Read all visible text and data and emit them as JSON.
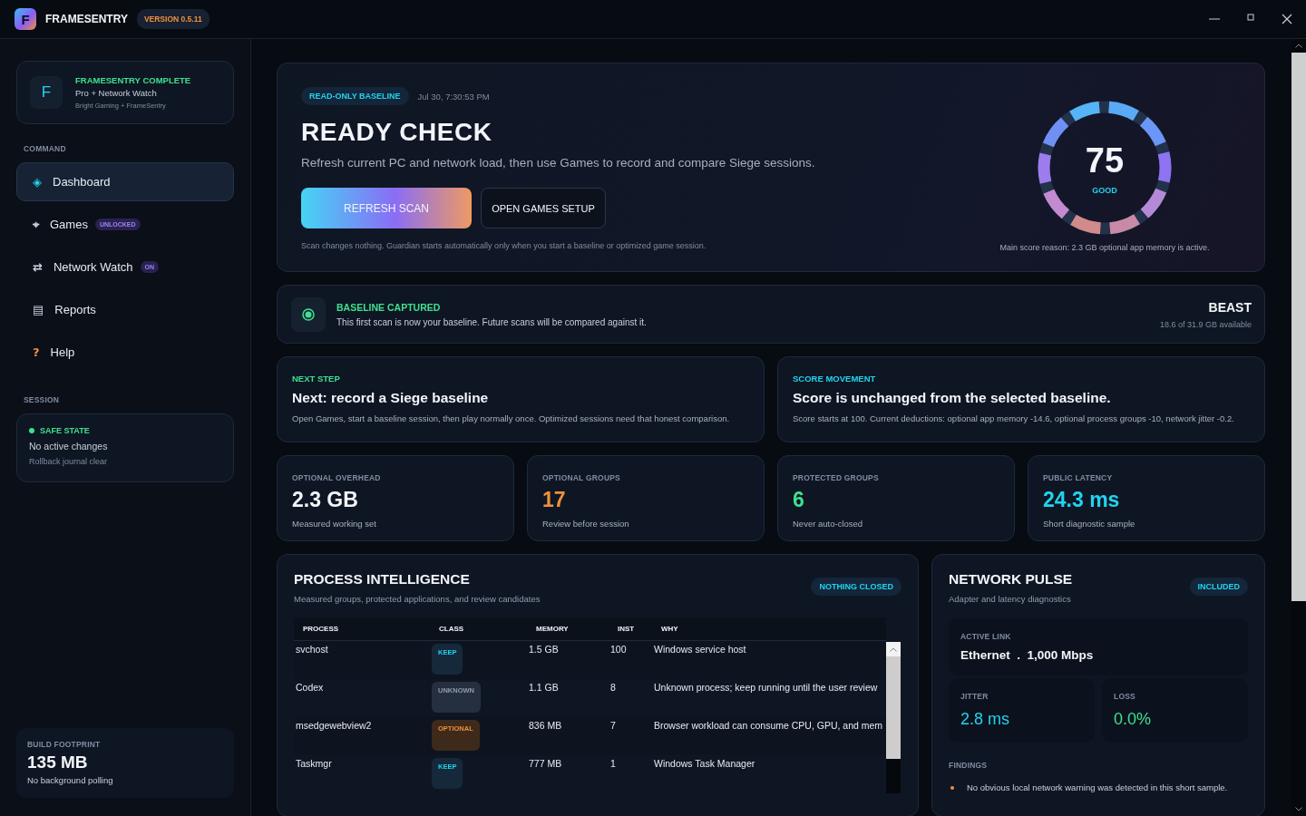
{
  "app": {
    "logo_letter": "F",
    "name": "FRAMESENTRY",
    "version": "VERSION 0.5.11"
  },
  "sidebar": {
    "brand": {
      "letter": "F",
      "title": "FRAMESENTRY COMPLETE",
      "subtitle": "Pro + Network Watch",
      "caption": "Bright Gaming + FrameSentry"
    },
    "sections": [
      {
        "heading": "COMMAND",
        "items": [
          {
            "icon": "◈",
            "color": "#22d3ee",
            "label": "Dashboard",
            "selected": true
          },
          {
            "icon": "⌖",
            "color": "#c7d0dc",
            "label": "Games",
            "badge": "UNLOCKED",
            "selected": false
          },
          {
            "icon": "⇄",
            "color": "#c7d0dc",
            "label": "Network Watch",
            "badge": "ON",
            "selected": false
          },
          {
            "icon": "▤",
            "color": "#c7d0dc",
            "label": "Reports",
            "selected": false
          },
          {
            "icon": "?",
            "color": "#f0903c",
            "label": "Help",
            "selected": false
          }
        ]
      }
    ],
    "session": {
      "heading": "SESSION",
      "status": "SAFE STATE",
      "line": "No active changes",
      "caption": "Rollback journal clear"
    },
    "footprint": {
      "label": "BUILD FOOTPRINT",
      "value": "135 MB",
      "note": "No background polling"
    }
  },
  "hero": {
    "tag": "READ-ONLY BASELINE",
    "timestamp": "Jul 30, 7:30:53 PM",
    "title": "READY CHECK",
    "description": "Refresh current PC and network load, then use Games to record and compare Siege sessions.",
    "buttons": [
      {
        "label": "REFRESH SCAN",
        "kind": "primary"
      },
      {
        "label": "OPEN GAMES SETUP",
        "kind": "secondary"
      }
    ],
    "note": "Scan changes nothing. Guardian starts automatically only when you start a baseline or optimized game session.",
    "score": {
      "value": "75",
      "rating": "GOOD",
      "reason": "Main score reason: 2.3 GB optional app memory is active."
    }
  },
  "baseline": {
    "title": "BASELINE CAPTURED",
    "text": "This first scan is now your baseline. Future scans will be compared against it.",
    "machine": "BEAST",
    "memory": "18.6 of 31.9 GB available"
  },
  "info_cards": [
    {
      "heading": "NEXT STEP",
      "color": "#3ee08f",
      "title": "Next: record a Siege baseline",
      "text": "Open Games, start a baseline session, then play normally once. Optimized sessions need that honest comparison."
    },
    {
      "heading": "SCORE MOVEMENT",
      "color": "#22d3ee",
      "title": "Score is unchanged from the selected baseline.",
      "text": "Score starts at 100. Current deductions: optional app memory -14.6, optional process groups -10, network jitter -0.2."
    }
  ],
  "stats": [
    {
      "label": "OPTIONAL OVERHEAD",
      "value": "2.3 GB",
      "color": "#f2f5f9",
      "note": "Measured working set"
    },
    {
      "label": "OPTIONAL GROUPS",
      "value": "17",
      "color": "#f0903c",
      "note": "Review before session"
    },
    {
      "label": "PROTECTED GROUPS",
      "value": "6",
      "color": "#3ee08f",
      "note": "Never auto-closed"
    },
    {
      "label": "PUBLIC LATENCY",
      "value": "24.3 ms",
      "color": "#22d3ee",
      "note": "Short diagnostic sample"
    }
  ],
  "process_panel": {
    "title": "PROCESS INTELLIGENCE",
    "subtitle": "Measured groups, protected applications, and review candidates",
    "badge": "NOTHING CLOSED",
    "table": {
      "columns": [
        "PROCESS",
        "CLASS",
        "MEMORY",
        "INST",
        "WHY"
      ],
      "rows": [
        {
          "process": "svchost",
          "class": {
            "label": "KEEP",
            "kind": "keep"
          },
          "memory": "1.5 GB",
          "inst": "100",
          "why": "Windows service host"
        },
        {
          "process": "Codex",
          "class": {
            "label": "UNKNOWN",
            "kind": "unknown"
          },
          "memory": "1.1 GB",
          "inst": "8",
          "why": "Unknown process; keep running until the user review"
        },
        {
          "process": "msedgewebview2",
          "class": {
            "label": "OPTIONAL",
            "kind": "optional"
          },
          "memory": "836 MB",
          "inst": "7",
          "why": "Browser workload can consume CPU, GPU, and mem"
        },
        {
          "process": "Taskmgr",
          "class": {
            "label": "KEEP",
            "kind": "keep"
          },
          "memory": "777 MB",
          "inst": "1",
          "why": "Windows Task Manager"
        }
      ]
    }
  },
  "network_panel": {
    "title": "NETWORK PULSE",
    "subtitle": "Adapter and latency diagnostics",
    "badge": "INCLUDED",
    "active_link": {
      "label": "ACTIVE LINK",
      "value": "Ethernet  .  1,000 Mbps"
    },
    "metrics": [
      {
        "label": "JITTER",
        "value": "2.8 ms",
        "color": "#22d3ee"
      },
      {
        "label": "LOSS",
        "value": "0.0%",
        "color": "#3ee08f"
      }
    ],
    "findings": {
      "heading": "FINDINGS",
      "items": [
        "No obvious local network warning was detected in this short sample."
      ]
    }
  }
}
